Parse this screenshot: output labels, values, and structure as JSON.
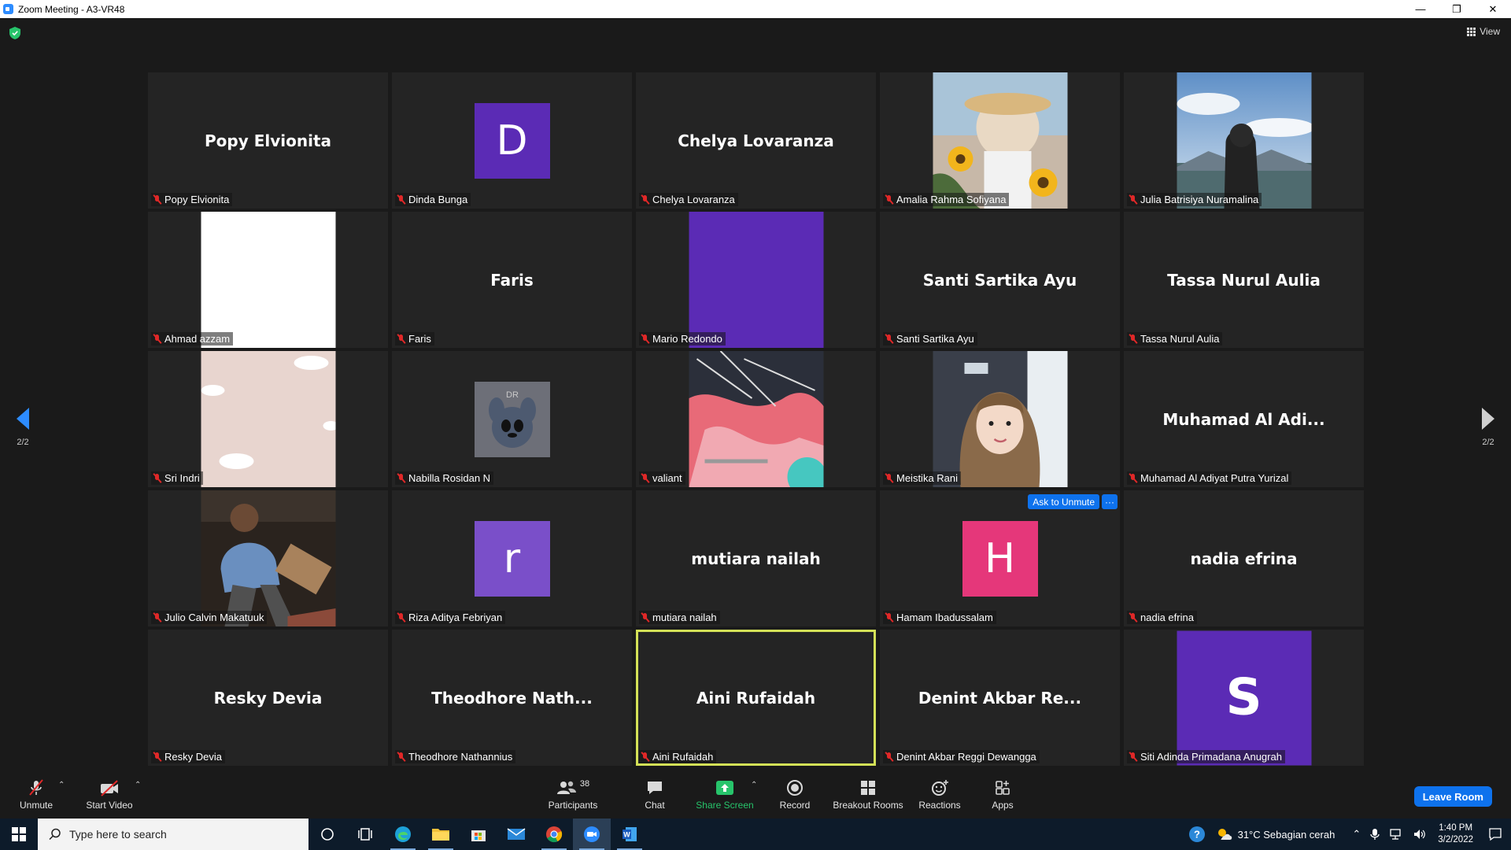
{
  "window": {
    "title": "Zoom Meeting - A3-VR48"
  },
  "top": {
    "view_label": "View"
  },
  "pagination": {
    "left": "2/2",
    "right": "2/2"
  },
  "tiles": [
    {
      "name": "Popy Elvionita",
      "display": "Popy Elvionita",
      "kind": "text"
    },
    {
      "name": "Dinda Bunga",
      "kind": "avatar",
      "letter": "D",
      "color": "#5b2bb5"
    },
    {
      "name": "Chelya Lovaranza",
      "display": "Chelya Lovaranza",
      "kind": "text"
    },
    {
      "name": "Amalia Rahma Sofiyana",
      "kind": "photo"
    },
    {
      "name": "Julia Batrisiya Nuramalina",
      "kind": "photo"
    },
    {
      "name": "Ahmad azzam",
      "kind": "photo"
    },
    {
      "name": "Faris",
      "display": "Faris",
      "kind": "text"
    },
    {
      "name": "Mario Redondo",
      "kind": "photo"
    },
    {
      "name": "Santi Sartika Ayu",
      "display": "Santi Sartika Ayu",
      "kind": "text"
    },
    {
      "name": "Tassa Nurul Aulia",
      "display": "Tassa Nurul Aulia",
      "kind": "text"
    },
    {
      "name": "Sri Indri",
      "kind": "photo"
    },
    {
      "name": "Nabilla Rosidan N",
      "kind": "photo"
    },
    {
      "name": "valiant",
      "kind": "photo"
    },
    {
      "name": "Meistika Rani",
      "kind": "photo"
    },
    {
      "name": "Muhamad Al Adiyat Putra Yurizal",
      "display": "Muhamad Al Adi...",
      "kind": "text"
    },
    {
      "name": "Julio Calvin Makatuuk",
      "kind": "photo"
    },
    {
      "name": "Riza Aditya Febriyan",
      "kind": "avatar",
      "letter": "r",
      "color": "#7a4fc9"
    },
    {
      "name": "mutiara nailah",
      "display": "mutiara nailah",
      "kind": "text"
    },
    {
      "name": "Hamam Ibadussalam",
      "kind": "avatar",
      "letter": "H",
      "color": "#e5377a"
    },
    {
      "name": "nadia efrina",
      "display": "nadia efrina",
      "kind": "text"
    },
    {
      "name": "Resky Devia",
      "display": "Resky Devia",
      "kind": "text"
    },
    {
      "name": "Theodhore Nathannius",
      "display": "Theodhore Nath...",
      "kind": "text"
    },
    {
      "name": "Aini Rufaidah",
      "display": "Aini Rufaidah",
      "kind": "text",
      "active": true
    },
    {
      "name": "Denint Akbar Reggi Dewangga",
      "display": "Denint Akbar Re...",
      "kind": "text"
    },
    {
      "name": "Siti Adinda Primadana Anugrah",
      "kind": "avatar",
      "letter": "S",
      "color": "#5b2bb5",
      "large": true
    }
  ],
  "hover_tile": {
    "ask_unmute_label": "Ask to Unmute",
    "more_label": "···"
  },
  "toolbar": {
    "unmute": "Unmute",
    "start_video": "Start Video",
    "participants": "Participants",
    "participant_count": "38",
    "chat": "Chat",
    "share_screen": "Share Screen",
    "record": "Record",
    "breakout_rooms": "Breakout Rooms",
    "reactions": "Reactions",
    "apps": "Apps",
    "leave": "Leave Room"
  },
  "taskbar": {
    "search_placeholder": "Type here to search",
    "weather": "31°C  Sebagian cerah",
    "time": "1:40 PM",
    "date": "3/2/2022"
  },
  "colors": {
    "accent": "#0e72ed",
    "share_green": "#27c46b",
    "active_speaker": "#d4e157",
    "muted_red": "#e02828"
  }
}
